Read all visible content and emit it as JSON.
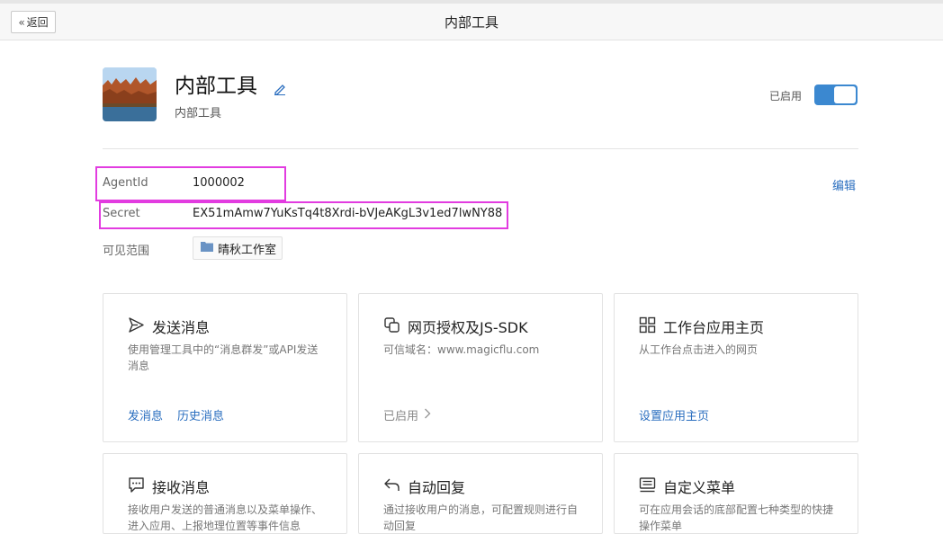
{
  "topbar": {
    "back_label": "返回",
    "title": "内部工具"
  },
  "app": {
    "name": "内部工具",
    "subtitle": "内部工具",
    "status_label": "已启用",
    "enabled": true
  },
  "info": {
    "agentid_label": "AgentId",
    "agentid_value": "1000002",
    "secret_label": "Secret",
    "secret_value": "EX51mAmw7YuKsTq4t8Xrdi-bVJeAKgL3v1ed7lwNY88",
    "scope_label": "可见范围",
    "scope_value": "晴秋工作室",
    "edit_label": "编辑"
  },
  "cards": {
    "send": {
      "title": "发送消息",
      "desc": "使用管理工具中的“消息群发”或API发送消息",
      "link1": "发消息",
      "link2": "历史消息"
    },
    "oauth": {
      "title": "网页授权及JS-SDK",
      "desc": "可信域名：www.magicflu.com",
      "status": "已启用"
    },
    "workbench": {
      "title": "工作台应用主页",
      "desc": "从工作台点击进入的网页",
      "link": "设置应用主页"
    },
    "receive": {
      "title": "接收消息",
      "desc": "接收用户发送的普通消息以及菜单操作、进入应用、上报地理位置等事件信息"
    },
    "autoreply": {
      "title": "自动回复",
      "desc": "通过接收用户的消息，可配置规则进行自动回复"
    },
    "menu": {
      "title": "自定义菜单",
      "desc": "可在应用会话的底部配置七种类型的快捷操作菜单"
    }
  },
  "colors": {
    "accent": "#3b88d0",
    "link": "#2a6ebf",
    "highlight": "#e23ce0"
  }
}
